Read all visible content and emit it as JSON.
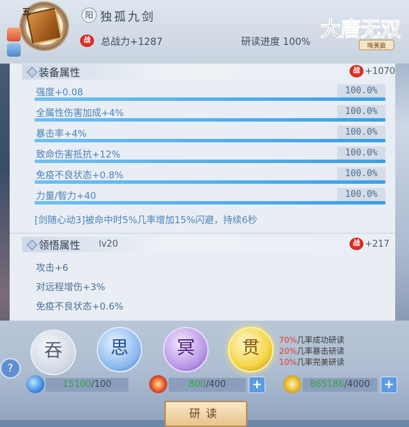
{
  "header": {
    "grade": "五",
    "yang_label": "阳",
    "title": "独孤九剑",
    "power_label": "总战力+1287",
    "progress_label": "研读进度 100%",
    "logo_main": "大唐无双",
    "logo_sub": "唯美篇",
    "fight_icon": "战"
  },
  "equip_section": {
    "title": "装备属性",
    "power": "+1070",
    "attributes": [
      {
        "text": "强度+0.08",
        "pct": "100.0%",
        "fill": 1.0
      },
      {
        "text": "全属性伤害加成+4%",
        "pct": "100.0%",
        "fill": 1.0
      },
      {
        "text": "暴击率+4%",
        "pct": "100.0%",
        "fill": 1.0
      },
      {
        "text": "致命伤害抵抗+12%",
        "pct": "100.0%",
        "fill": 1.0
      },
      {
        "text": "免疫不良状态+0.8%",
        "pct": "100.0%",
        "fill": 1.0
      },
      {
        "text": "力量/智力+40",
        "pct": "100.0%",
        "fill": 1.0
      }
    ],
    "skill": "[剑随心动3]被命中时5%几率增加15%闪避，持续6秒"
  },
  "comprehend_section": {
    "title": "领悟属性",
    "level": "lv20",
    "power": "+217",
    "attributes": [
      "攻击+6",
      "对远程增伤+3%",
      "免疫不良状态+0.6%"
    ]
  },
  "orbs": [
    {
      "char": "吞"
    },
    {
      "char": "思"
    },
    {
      "char": "冥"
    },
    {
      "char": "贯"
    }
  ],
  "rates": [
    {
      "pct": "70%",
      "text": "几率成功研读"
    },
    {
      "pct": "20%",
      "text": "几率暴击研读"
    },
    {
      "pct": "10%",
      "text": "几率完美研读"
    }
  ],
  "help": "?",
  "resources": [
    {
      "cur": "15100",
      "total": "/100"
    },
    {
      "cur": "800",
      "total": "/400"
    },
    {
      "cur": "865186",
      "total": "/4000"
    }
  ],
  "plus": "+",
  "study_button": "研读",
  "colors": {
    "accent_blue": "#4a82b8",
    "bar_fill": "#3aa0e6",
    "rate_red": "#e23c2c"
  }
}
